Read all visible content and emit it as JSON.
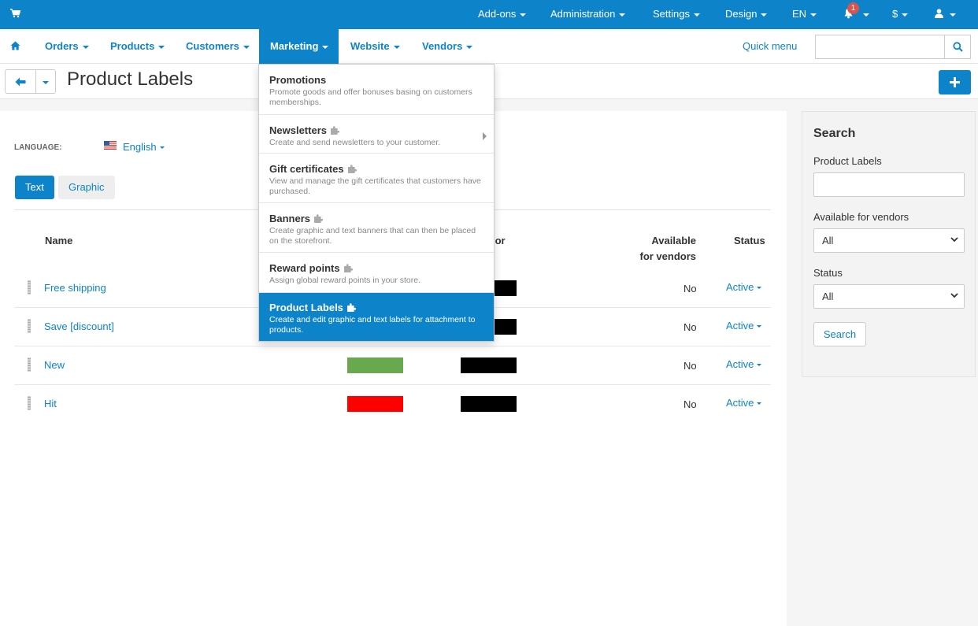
{
  "topbar": {
    "addons": "Add-ons",
    "administration": "Administration",
    "settings": "Settings",
    "design": "Design",
    "language": "EN",
    "notifications_count": "1",
    "currency": "$"
  },
  "nav": {
    "orders": "Orders",
    "products": "Products",
    "customers": "Customers",
    "marketing": "Marketing",
    "website": "Website",
    "vendors": "Vendors",
    "quick_menu": "Quick menu",
    "search_value": ""
  },
  "page": {
    "title": "Product Labels"
  },
  "language": {
    "label": "LANGUAGE:",
    "value": "English"
  },
  "tabs": {
    "text": "Text",
    "graphic": "Graphic"
  },
  "table": {
    "headers": {
      "name": "Name",
      "color": "lor",
      "available_line1": "Available",
      "available_line2": "for vendors",
      "status": "Status"
    },
    "rows": [
      {
        "name": "Free shipping",
        "available": "No",
        "status": "Active",
        "color1": "",
        "color2": "#000000"
      },
      {
        "name": "Save [discount]",
        "available": "No",
        "status": "Active",
        "color1": "",
        "color2": "#000000"
      },
      {
        "name": "New",
        "available": "No",
        "status": "Active",
        "color1": "#69a84f",
        "color2": "#000000"
      },
      {
        "name": "Hit",
        "available": "No",
        "status": "Active",
        "color1": "#ff0000",
        "color2": "#000000"
      }
    ]
  },
  "sidebar": {
    "title": "Search",
    "labels_label": "Product Labels",
    "labels_value": "",
    "vendors_label": "Available for vendors",
    "vendors_value": "All",
    "status_label": "Status",
    "status_value": "All",
    "search_button": "Search"
  },
  "marketing_menu": [
    {
      "title": "Promotions",
      "desc": "Promote goods and offer bonuses basing on customers memberships.",
      "addon": false,
      "submenu": false,
      "selected": false
    },
    {
      "title": "Newsletters",
      "desc": "Create and send newsletters to your customer.",
      "addon": true,
      "submenu": true,
      "selected": false
    },
    {
      "title": "Gift certificates",
      "desc": "View and manage the gift certificates that customers have purchased.",
      "addon": true,
      "submenu": false,
      "selected": false
    },
    {
      "title": "Banners",
      "desc": "Create graphic and text banners that can then be placed on the storefront.",
      "addon": true,
      "submenu": false,
      "selected": false
    },
    {
      "title": "Reward points",
      "desc": "Assign global reward points in your store.",
      "addon": true,
      "submenu": false,
      "selected": false
    },
    {
      "title": "Product Labels",
      "desc": "Create and edit graphic and text labels for attachment to products.",
      "addon": true,
      "submenu": false,
      "selected": true
    }
  ],
  "colors": {
    "accent": "#0d84c9",
    "badge": "#d9534f"
  },
  "icons": [
    "cart-icon",
    "home-icon",
    "bell-icon",
    "user-icon",
    "search-icon",
    "arrow-left-icon",
    "plus-icon",
    "puzzle-icon",
    "flag-icon"
  ]
}
